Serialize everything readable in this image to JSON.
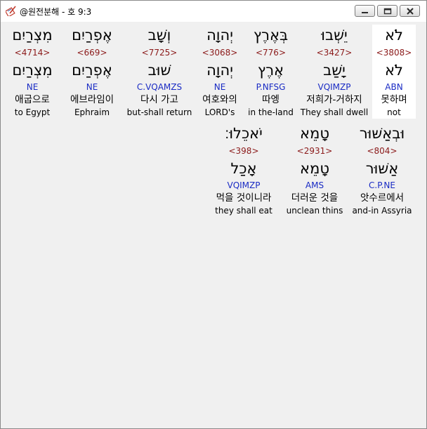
{
  "window": {
    "title": "@원전분해 - 호 9:3",
    "icon": "pen-book-icon"
  },
  "colors": {
    "strong": "#8b1a1a",
    "morph": "#1a2bc4",
    "selected_bg": "#ffffff",
    "panel_bg": "#f0f0f0"
  },
  "words": [
    {
      "heb": "לֹא",
      "strong": "<3808>",
      "lemma": "לֹא",
      "morph": "ABN",
      "kor": "못하며",
      "eng": "not",
      "selected": true
    },
    {
      "heb": "יֵשְׁבוּ",
      "strong": "<3427>",
      "lemma": "יָשַׁב",
      "morph": "VQIMZP",
      "kor": "저희가-거하지",
      "eng": "They shall dwell"
    },
    {
      "heb": "בְּאֶרֶץ",
      "strong": "<776>",
      "lemma": "אֶרֶץ",
      "morph": "P.NFSG",
      "kor": "따엥",
      "eng": "in the-land"
    },
    {
      "heb": "יְהוָה",
      "strong": "<3068>",
      "lemma": "יְהוָה",
      "morph": "NE",
      "kor": "여호와의",
      "eng": "LORD's"
    },
    {
      "heb": "וְשָׁב",
      "strong": "<7725>",
      "lemma": "שׁוּב",
      "morph": "C.VQAMZS",
      "kor": "다시 가고",
      "eng": "but-shall return"
    },
    {
      "heb": "אֶפְרַיִם",
      "strong": "<669>",
      "lemma": "אֶפְרַיִם",
      "morph": "NE",
      "kor": "에브라임이",
      "eng": "Ephraim"
    },
    {
      "heb": "מִצְרַיִם",
      "strong": "<4714>",
      "lemma": "מִצְרַיִם",
      "morph": "NE",
      "kor": "애굽으로",
      "eng": "to Egypt"
    },
    {
      "heb": "וּבְאַשּׁוּר",
      "strong": "<804>",
      "lemma": "אַשּׁוּר",
      "morph": "C.P.NE",
      "kor": "앗수르에서",
      "eng": "and-in Assyria"
    },
    {
      "heb": "טָמֵא",
      "strong": "<2931>",
      "lemma": "טָמֵא",
      "morph": "AMS",
      "kor": "더러운 것을",
      "eng": "unclean thins"
    },
    {
      "heb": "יֹאכֵלוּ׃",
      "strong": "<398>",
      "lemma": "אָכַל",
      "morph": "VQIMZP",
      "kor": "먹을 것이니라",
      "eng": "they shall eat"
    }
  ]
}
